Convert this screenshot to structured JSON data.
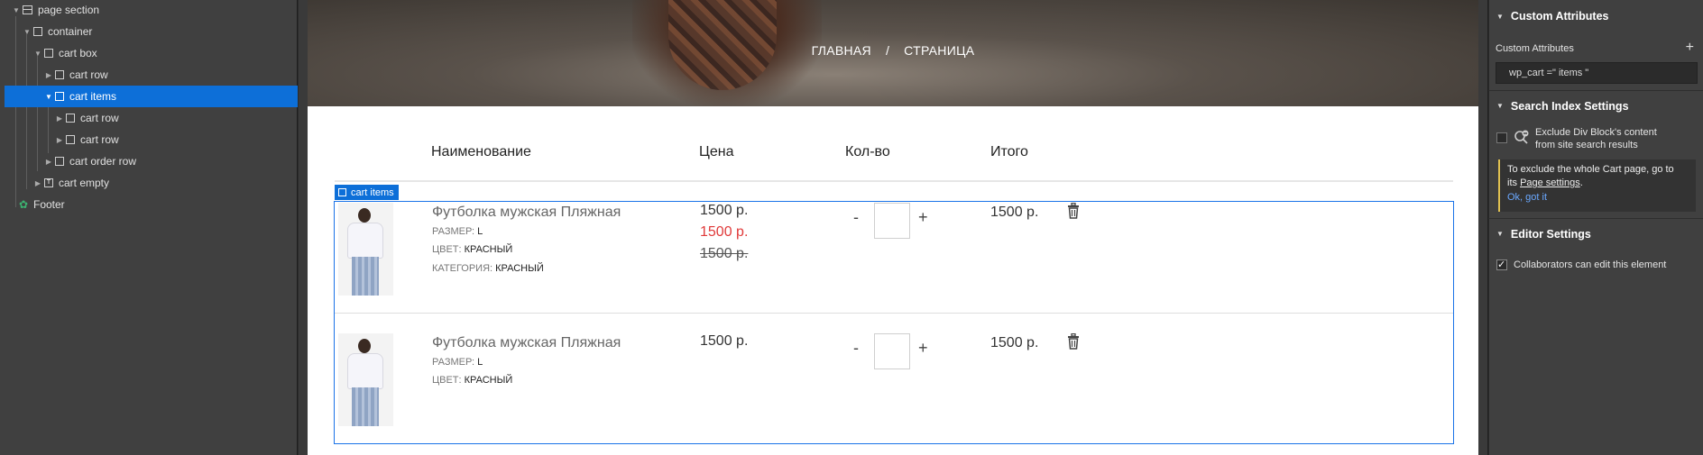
{
  "navigator": {
    "items": [
      {
        "label": "page section",
        "icon": "section-icon"
      },
      {
        "label": "container",
        "icon": "box-icon"
      },
      {
        "label": "cart box",
        "icon": "box-icon"
      },
      {
        "label": "cart row",
        "icon": "box-icon"
      },
      {
        "label": "cart items",
        "icon": "box-icon",
        "selected": true
      },
      {
        "label": "cart row",
        "icon": "box-icon"
      },
      {
        "label": "cart row",
        "icon": "box-icon"
      },
      {
        "label": "cart order row",
        "icon": "box-icon"
      },
      {
        "label": "cart empty",
        "icon": "symbol-icon"
      },
      {
        "label": "Footer",
        "icon": "component-icon"
      }
    ]
  },
  "hero": {
    "breadcrumb_home": "ГЛАВНАЯ",
    "breadcrumb_sep": "/",
    "breadcrumb_page": "СТРАНИЦА"
  },
  "table": {
    "headers": [
      "Наименование",
      "Цена",
      "Кол-во",
      "Итого"
    ],
    "selected_tag": "cart items",
    "items": [
      {
        "name": "Футболка мужская Пляжная",
        "size_label": "РАЗМЕР:",
        "size": "L",
        "color_label": "ЦВЕТ:",
        "color": "КРАСНЫЙ",
        "category_label": "КАТЕГОРИЯ:",
        "category": "КРАСНЫЙ",
        "price": "1500 р.",
        "price_sale": "1500 р.",
        "price_old": "1500 р.",
        "minus": "-",
        "plus": "+",
        "total": "1500 р."
      },
      {
        "name": "Футболка мужская Пляжная",
        "size_label": "РАЗМЕР:",
        "size": "L",
        "color_label": "ЦВЕТ:",
        "color": "КРАСНЫЙ",
        "price": "1500 р.",
        "minus": "-",
        "plus": "+",
        "total": "1500 р."
      }
    ]
  },
  "panel": {
    "custom_attributes": {
      "title": "Custom Attributes",
      "label": "Custom Attributes",
      "add": "+",
      "value": "wp_cart =\" items \""
    },
    "search_index": {
      "title": "Search Index Settings",
      "exclude_line1": "Exclude Div Block's content",
      "exclude_line2": "from site search results",
      "info_line1": "To exclude the whole Cart page, go to",
      "info_its": "its",
      "info_link": "Page settings",
      "info_dot": ".",
      "ok": "Ok, got it"
    },
    "editor": {
      "title": "Editor Settings",
      "collab": "Collaborators can edit this element"
    }
  },
  "colors": {
    "accent": "#0d6fd8",
    "sale": "#e03a3a",
    "panel_bg": "#404040"
  }
}
